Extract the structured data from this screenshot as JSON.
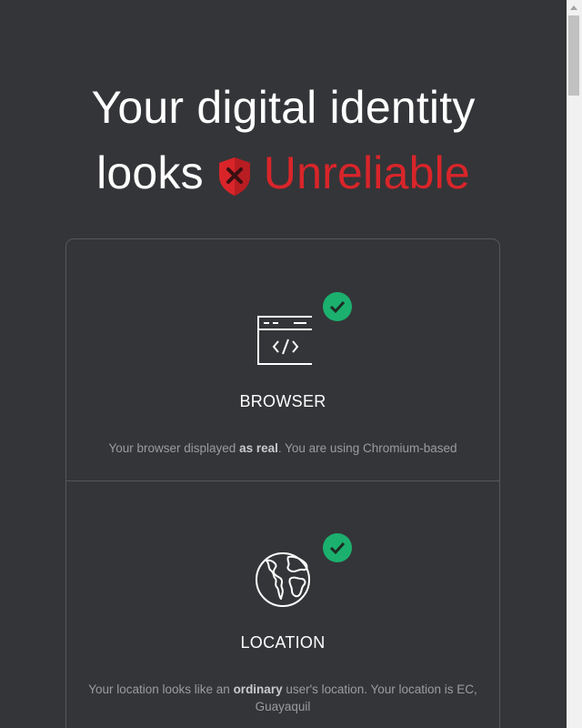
{
  "headline": {
    "line1": "Your digital identity",
    "line2_prefix": "looks",
    "status": "Unreliable",
    "status_color": "#d9252a",
    "status_icon": "shield-x-icon"
  },
  "sections": {
    "browser": {
      "title": "BROWSER",
      "icon": "browser-code-icon",
      "check_icon": "check-circle-icon",
      "desc_before": "Your browser displayed ",
      "desc_bold": "as real",
      "desc_after": ". You are using Chromium-based"
    },
    "location": {
      "title": "LOCATION",
      "icon": "globe-icon",
      "check_icon": "check-circle-icon",
      "desc_before": "Your location looks like an ",
      "desc_bold": "ordinary",
      "desc_after": " user's location. Your location is EC, Guayaquil"
    }
  },
  "colors": {
    "background": "#343538",
    "success": "#1bb06e",
    "danger": "#d9252a"
  }
}
